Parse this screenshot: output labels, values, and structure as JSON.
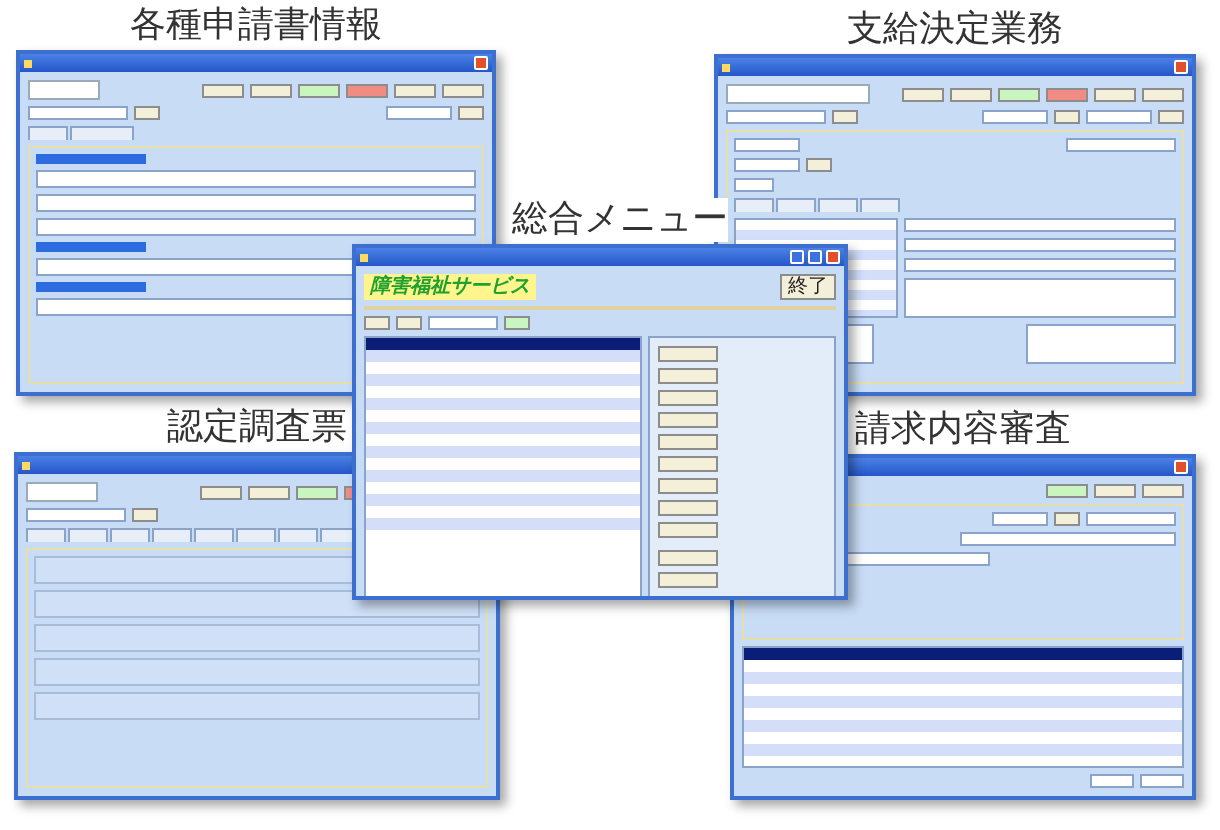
{
  "panels": [
    {
      "kind": "form",
      "caption": "各種申請書情報"
    },
    {
      "kind": "decision",
      "caption": "支給決定業務"
    },
    {
      "kind": "survey",
      "caption": "認定調査票"
    },
    {
      "kind": "review",
      "caption": "請求内容審査"
    },
    {
      "kind": "menu",
      "caption": "総合メニュー",
      "logo": "障害福祉サービス",
      "exit_button": "終了"
    }
  ]
}
